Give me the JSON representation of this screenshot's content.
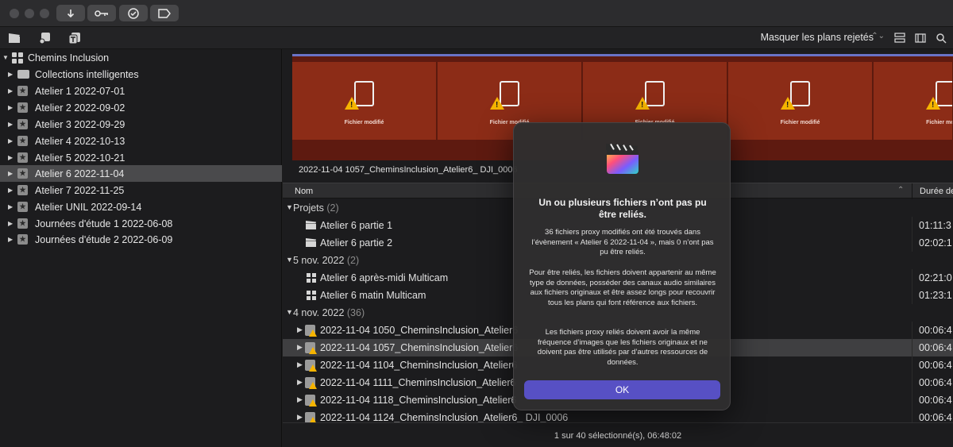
{
  "toolbar": {
    "buttons": [
      "download-icon",
      "key-icon",
      "checkmark-icon",
      "tag-icon"
    ],
    "filter_label": "Masquer les plans rejetés"
  },
  "sidebar": {
    "library": "Chemins Inclusion",
    "items": [
      {
        "label": "Collections intelligentes",
        "icon": "folder-icon"
      },
      {
        "label": "Atelier 1 2022-07-01",
        "icon": "event-icon"
      },
      {
        "label": "Atelier 2 2022-09-02",
        "icon": "event-icon"
      },
      {
        "label": "Atelier 3 2022-09-29",
        "icon": "event-icon"
      },
      {
        "label": "Atelier 4 2022-10-13",
        "icon": "event-icon"
      },
      {
        "label": "Atelier 5 2022-10-21",
        "icon": "event-icon"
      },
      {
        "label": "Atelier 6 2022-11-04",
        "icon": "event-icon"
      },
      {
        "label": "Atelier 7 2022-11-25",
        "icon": "event-icon"
      },
      {
        "label": "Atelier UNIL 2022-09-14",
        "icon": "event-icon"
      },
      {
        "label": "Journées d'étude 1 2022-06-08",
        "icon": "event-icon"
      },
      {
        "label": "Journées d'étude 2 2022-06-09",
        "icon": "event-icon"
      }
    ],
    "selected_index": 6
  },
  "filmstrip": {
    "thumb_label": "Fichier modifié",
    "clip_name": "2022-11-04 1057_CheminsInclusion_Atelier6_ DJI_0006"
  },
  "list": {
    "col_name": "Nom",
    "col_duration": "Durée de",
    "groups": [
      {
        "label": "Projets",
        "count": "(2)",
        "rows": [
          {
            "name": "Atelier 6 partie 1",
            "duration": "01:11:3",
            "icon": "clapper-icon"
          },
          {
            "name": "Atelier 6 partie 2",
            "duration": "02:02:1",
            "icon": "clapper-icon"
          }
        ]
      },
      {
        "label": "5 nov. 2022",
        "count": "(2)",
        "rows": [
          {
            "name": "Atelier 6 après-midi Multicam",
            "duration": "02:21:0",
            "icon": "multicam-icon"
          },
          {
            "name": "Atelier 6 matin Multicam",
            "duration": "01:23:1",
            "icon": "multicam-icon"
          }
        ]
      },
      {
        "label": "4 nov. 2022",
        "count": "(36)",
        "rows": [
          {
            "name": "2022-11-04 1050_CheminsInclusion_Atelier6",
            "duration": "00:06:4",
            "icon": "missing-clip-icon"
          },
          {
            "name": "2022-11-04 1057_CheminsInclusion_Atelier6",
            "duration": "00:06:4",
            "icon": "missing-clip-icon"
          },
          {
            "name": "2022-11-04 1104_CheminsInclusion_Atelier6",
            "duration": "00:06:4",
            "icon": "missing-clip-icon"
          },
          {
            "name": "2022-11-04 1111_CheminsInclusion_Atelier6",
            "duration": "00:06:4",
            "icon": "missing-clip-icon"
          },
          {
            "name": "2022-11-04 1118_CheminsInclusion_Atelier6",
            "duration": "00:06:4",
            "icon": "missing-clip-icon"
          },
          {
            "name": "2022-11-04 1124_CheminsInclusion_Atelier6_ DJI_0006",
            "duration": "00:06:4",
            "icon": "missing-clip-icon"
          }
        ]
      }
    ],
    "selected_clip_index": 1,
    "status": "1 sur 40 sélectionné(s), 06:48:02"
  },
  "dialog": {
    "title": "Un ou plusieurs fichiers n’ont pas pu être reliés.",
    "p1": "36 fichiers proxy modifiés ont été trouvés dans l’évènement « Atelier 6 2022-11-04 », mais 0 n’ont pas pu être reliés.",
    "p2": "Pour être reliés, les fichiers doivent appartenir au même type de données, posséder des canaux audio similaires aux fichiers originaux et être assez longs pour recouvrir tous les plans qui font référence aux fichiers.",
    "p3": "Les fichiers proxy reliés doivent avoir la même fréquence d’images que les fichiers originaux et ne doivent pas être utilisés par d’autres ressources de données.",
    "ok": "OK"
  },
  "colors": {
    "accent": "#5750c4",
    "warning": "#f5b400",
    "thumb_bg": "#8c2c17"
  }
}
